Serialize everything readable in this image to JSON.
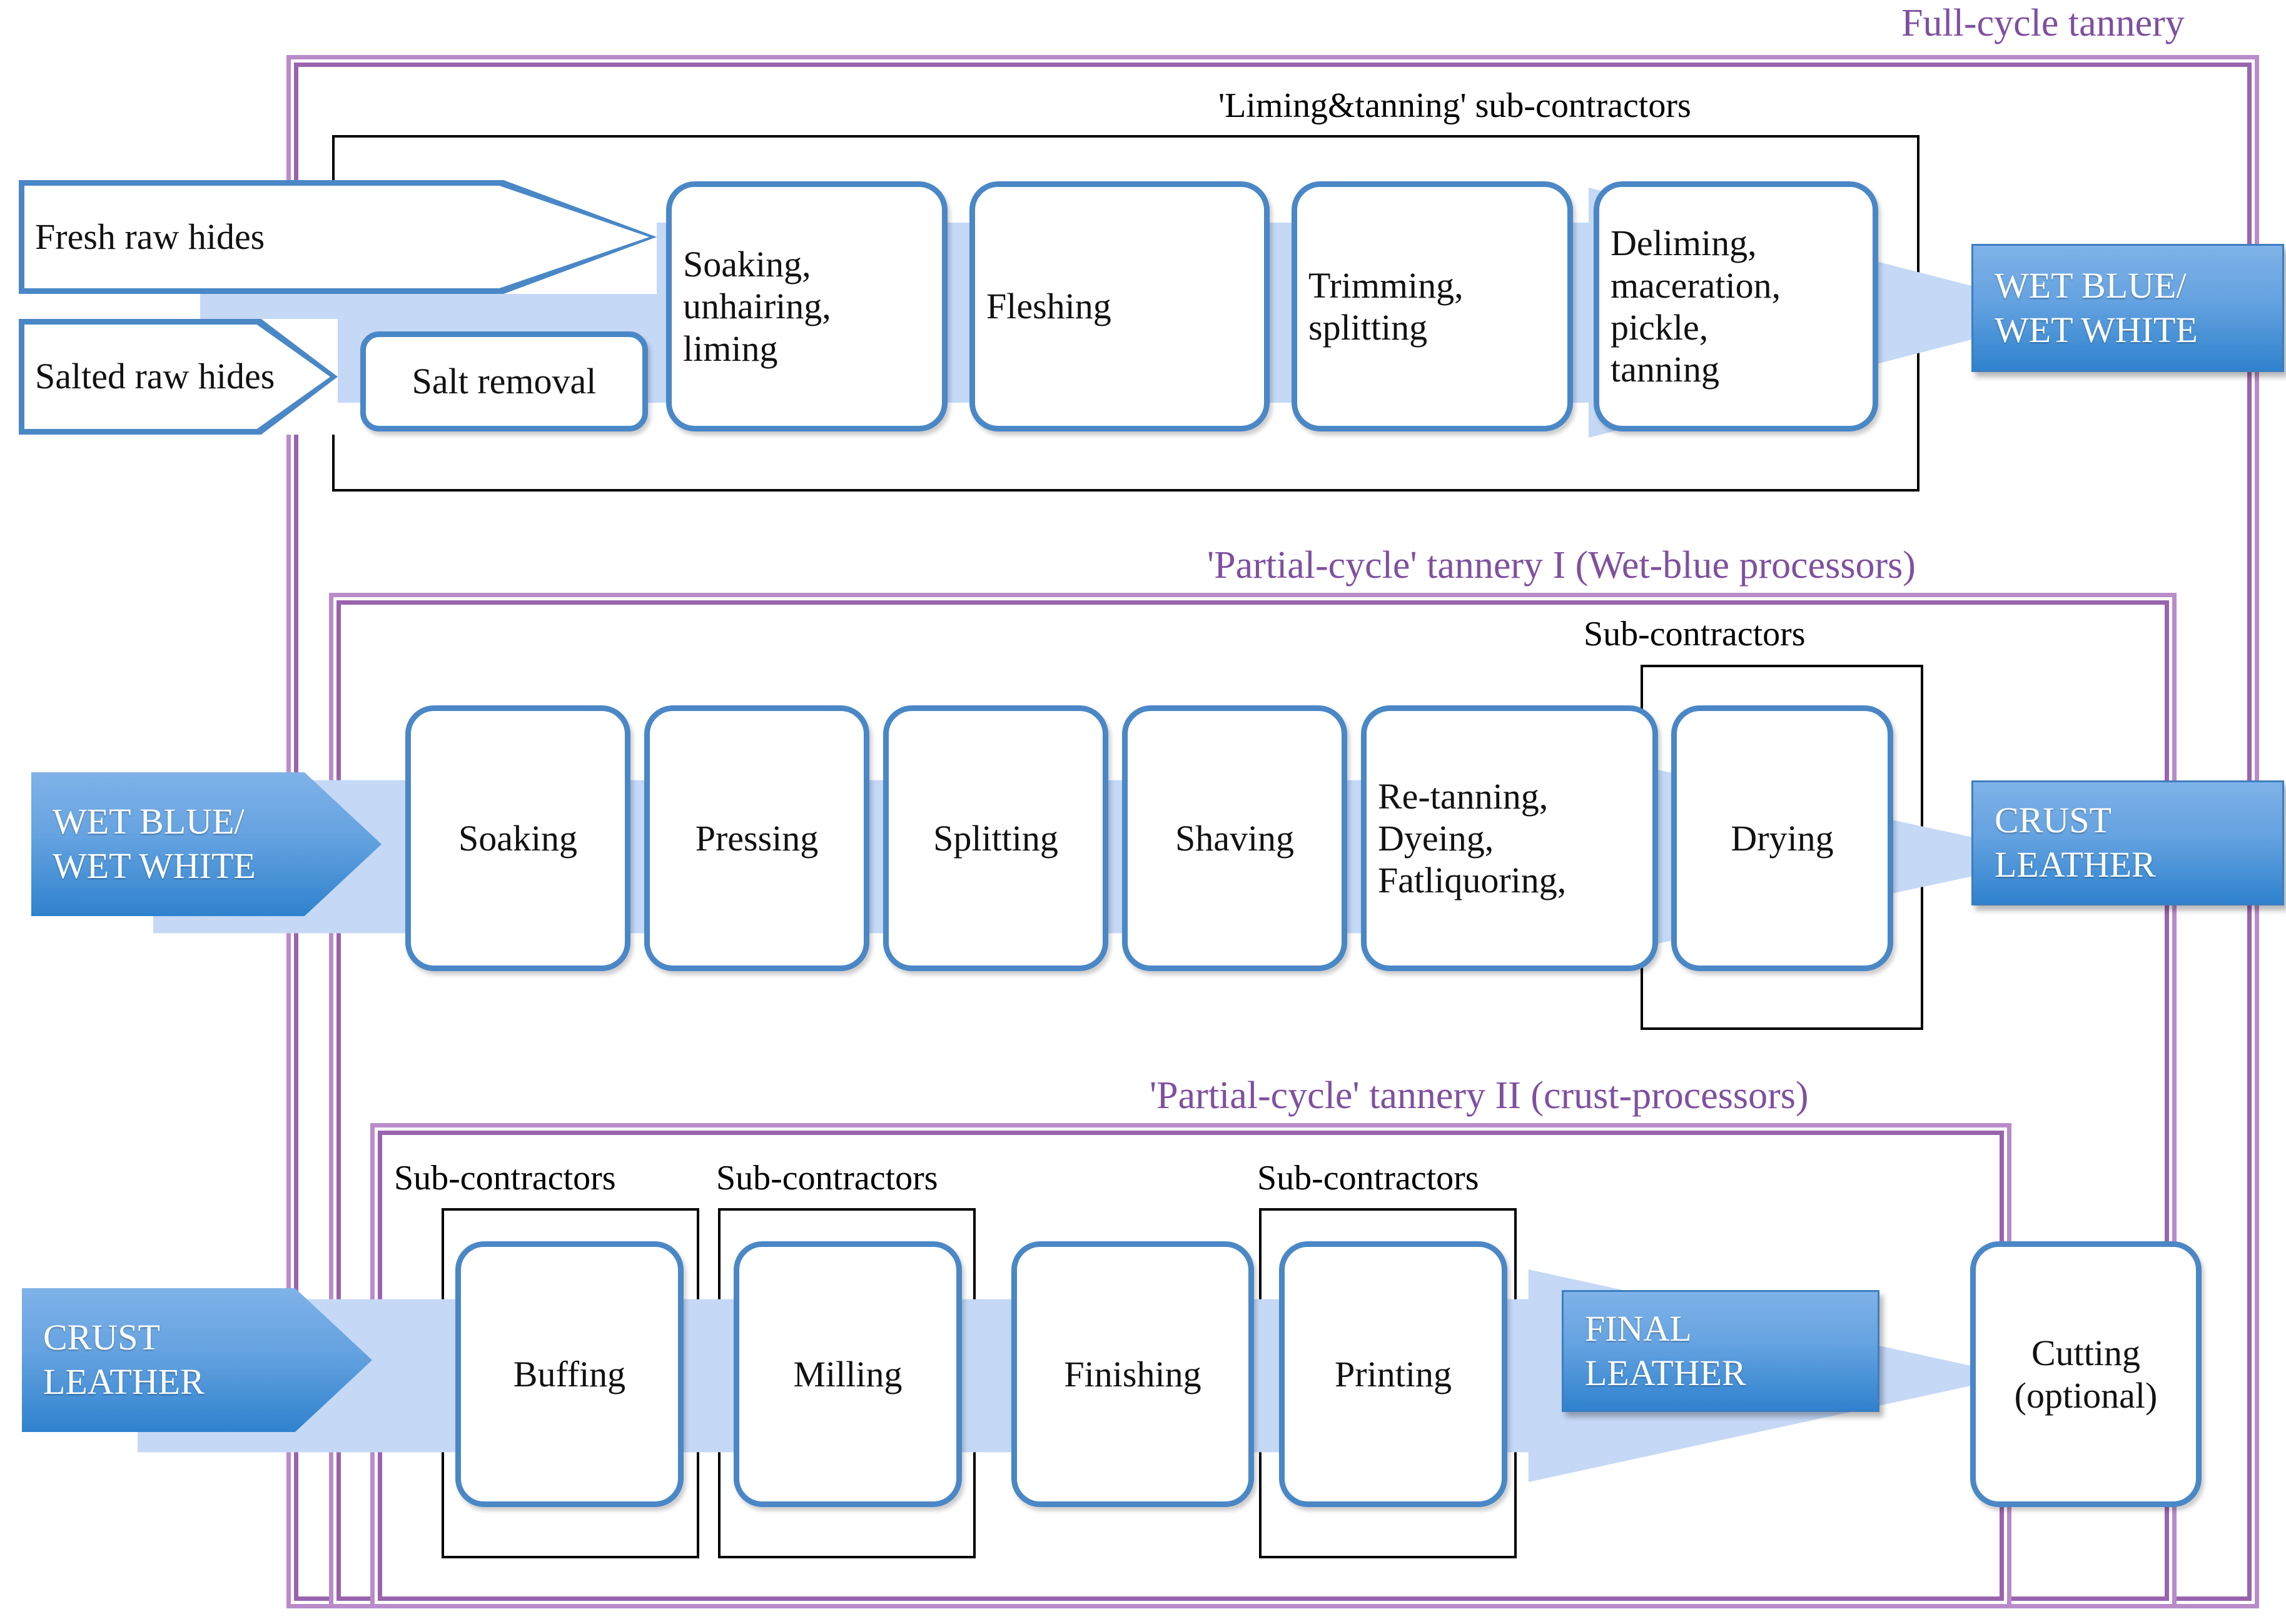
{
  "diagram": {
    "title_full_cycle": "Full-cycle tannery",
    "title_partial_I": "'Partial-cycle' tannery I (Wet-blue processors)",
    "title_partial_II": "'Partial-cycle' tannery II (crust-processors)",
    "colors": {
      "frame_purple": "#9a63ad",
      "frame_purple_light": "#b98bc9",
      "title_purple": "#7f4fa0",
      "box_blue": "#4a87c6",
      "arrow_band": "#c5d9f7",
      "material_blue": "#2f82ce",
      "subcontractor_black": "#000000"
    }
  },
  "row1": {
    "subcontractor_label": "'Liming&tanning' sub-contractors",
    "inputs": [
      {
        "label": "Fresh raw hides"
      },
      {
        "label": "Salted raw hides"
      }
    ],
    "salt_removal": "Salt removal",
    "steps": [
      {
        "lines": [
          "Soaking,",
          "unhairing,",
          "liming"
        ]
      },
      {
        "lines": [
          "Fleshing"
        ]
      },
      {
        "lines": [
          "Trimming,",
          "splitting"
        ]
      },
      {
        "lines": [
          "Deliming,",
          "maceration,",
          "pickle,",
          "tanning"
        ]
      }
    ],
    "output": {
      "lines": [
        "WET BLUE/",
        "WET WHITE"
      ]
    }
  },
  "row2": {
    "subcontractor_label": "Sub-contractors",
    "input": {
      "lines": [
        "WET BLUE/",
        "WET WHITE"
      ]
    },
    "steps": [
      {
        "lines": [
          "Soaking"
        ]
      },
      {
        "lines": [
          "Pressing"
        ]
      },
      {
        "lines": [
          "Splitting"
        ]
      },
      {
        "lines": [
          "Shaving"
        ]
      },
      {
        "lines": [
          "Re-tanning,",
          "Dyeing,",
          "Fatliquoring,"
        ]
      },
      {
        "lines": [
          "Drying"
        ]
      }
    ],
    "output": {
      "lines": [
        "CRUST",
        "LEATHER"
      ]
    }
  },
  "row3": {
    "subcontractor_labels": [
      "Sub-contractors",
      "Sub-contractors",
      "Sub-contractors"
    ],
    "input": {
      "lines": [
        "CRUST",
        "LEATHER"
      ]
    },
    "steps": [
      {
        "lines": [
          "Buffing"
        ]
      },
      {
        "lines": [
          "Milling"
        ]
      },
      {
        "lines": [
          "Finishing"
        ]
      },
      {
        "lines": [
          "Printing"
        ]
      }
    ],
    "final_material": {
      "lines": [
        "FINAL",
        "LEATHER"
      ]
    },
    "cutting": {
      "lines": [
        "Cutting",
        "(optional)"
      ]
    }
  }
}
